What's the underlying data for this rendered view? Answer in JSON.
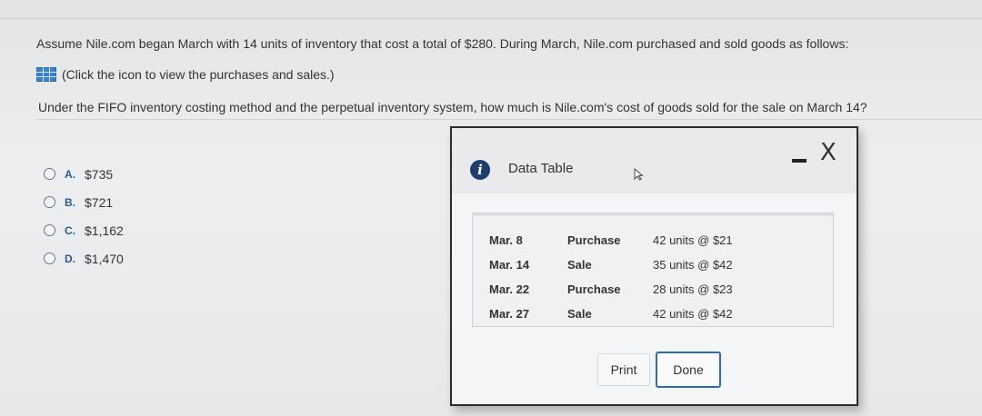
{
  "question": {
    "line1": "Assume Nile.com began March with 14 units of inventory that cost a total of $280. During March, Nile.com purchased and sold goods as follows:",
    "icon_link": "(Click the icon to view the purchases and sales.)",
    "line2": "Under the FIFO inventory costing method and the perpetual inventory system, how much is Nile.com's cost of goods sold for the sale on March 14?"
  },
  "options": [
    {
      "letter": "A.",
      "value": "$735"
    },
    {
      "letter": "B.",
      "value": "$721"
    },
    {
      "letter": "C.",
      "value": "$1,162"
    },
    {
      "letter": "D.",
      "value": "$1,470"
    }
  ],
  "dialog": {
    "title": "Data Table",
    "info_icon_glyph": "i",
    "close_glyph": "X",
    "rows": [
      {
        "date": "Mar. 8",
        "type": "Purchase",
        "qty": "42 units @ $21"
      },
      {
        "date": "Mar. 14",
        "type": "Sale",
        "qty": "35 units @ $42"
      },
      {
        "date": "Mar. 22",
        "type": "Purchase",
        "qty": "28 units @ $23"
      },
      {
        "date": "Mar. 27",
        "type": "Sale",
        "qty": "42 units @ $42"
      }
    ],
    "print_label": "Print",
    "done_label": "Done"
  },
  "colors": {
    "accent": "#2d6cb5",
    "info": "#1d3d6e",
    "option_letter": "#2d5a8f"
  }
}
